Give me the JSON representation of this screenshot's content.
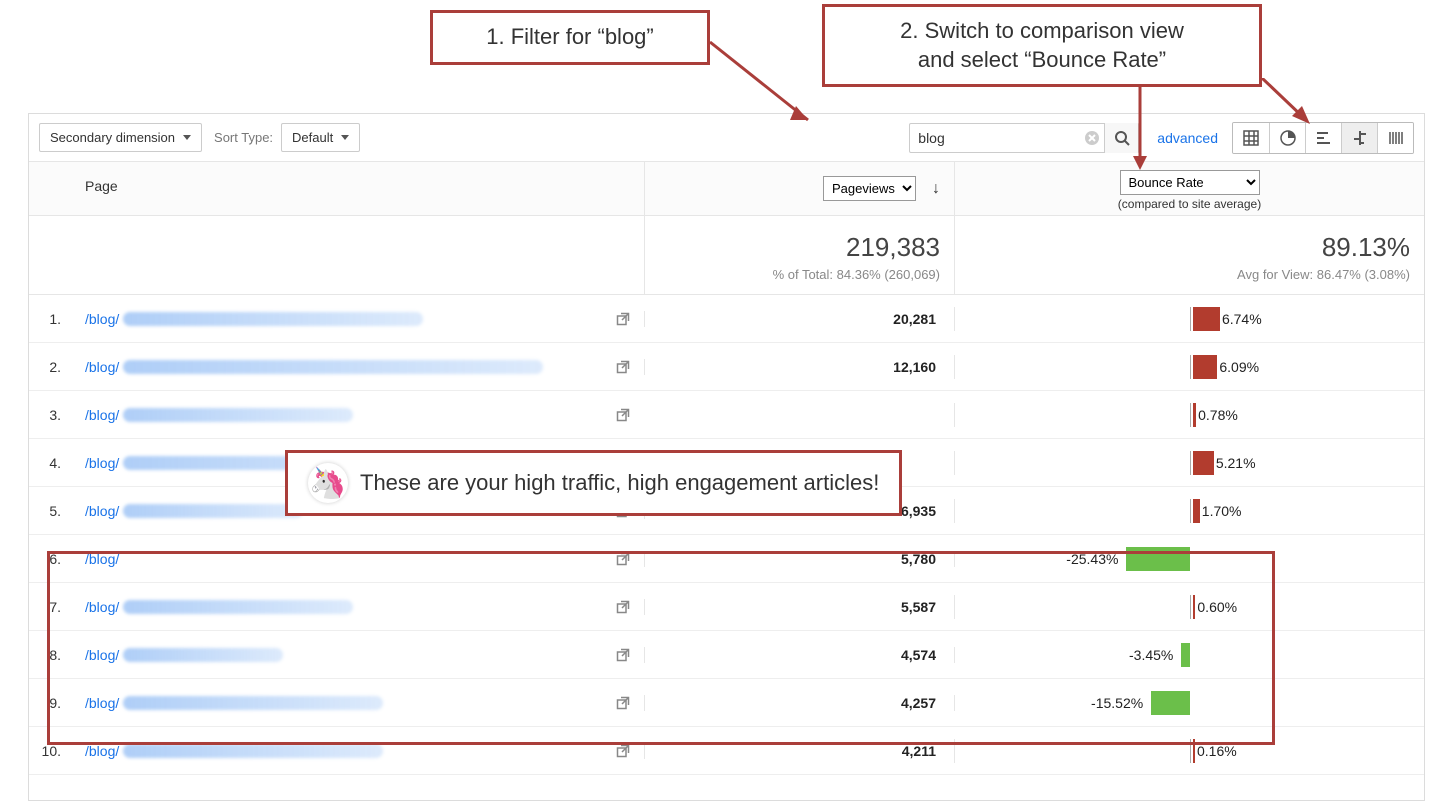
{
  "callouts": {
    "filter": "1. Filter for “blog”",
    "compare": "2. Switch to comparison view\nand select “Bounce Rate”",
    "annotation": "These are your high traffic, high engagement articles!",
    "unicorn": "🦄"
  },
  "toolbar": {
    "secondary_dimension": "Secondary dimension",
    "sort_type_label": "Sort Type:",
    "sort_type_value": "Default",
    "search_value": "blog",
    "advanced": "advanced"
  },
  "headers": {
    "page": "Page",
    "pageviews": "Pageviews",
    "bounce_rate": "Bounce Rate",
    "compared": "(compared to site average)"
  },
  "summary": {
    "pageviews": "219,383",
    "pageviews_note": "% of Total: 84.36% (260,069)",
    "bounce_rate": "89.13%",
    "bounce_note": "Avg for View: 86.47% (3.08%)"
  },
  "chart_data": {
    "type": "table",
    "axis_center_pct": 0,
    "rows": [
      {
        "idx": "1.",
        "page": "/blog/",
        "pageviews": "20,281",
        "pct": 6.74,
        "label": "6.74%"
      },
      {
        "idx": "2.",
        "page": "/blog/",
        "pageviews": "12,160",
        "pct": 6.09,
        "label": "6.09%"
      },
      {
        "idx": "3.",
        "page": "/blog/",
        "pageviews": "",
        "pct": 0.78,
        "label": "0.78%"
      },
      {
        "idx": "4.",
        "page": "/blog/",
        "pageviews": "",
        "pct": 5.21,
        "label": "5.21%"
      },
      {
        "idx": "5.",
        "page": "/blog/",
        "pageviews": "6,935",
        "pct": 1.7,
        "label": "1.70%"
      },
      {
        "idx": "6.",
        "page": "/blog/",
        "pageviews": "5,780",
        "pct": -25.43,
        "label": "-25.43%"
      },
      {
        "idx": "7.",
        "page": "/blog/",
        "pageviews": "5,587",
        "pct": 0.6,
        "label": "0.60%"
      },
      {
        "idx": "8.",
        "page": "/blog/",
        "pageviews": "4,574",
        "pct": -3.45,
        "label": "-3.45%"
      },
      {
        "idx": "9.",
        "page": "/blog/",
        "pageviews": "4,257",
        "pct": -15.52,
        "label": "-15.52%"
      },
      {
        "idx": "10.",
        "page": "/blog/",
        "pageviews": "4,211",
        "pct": 0.16,
        "label": "0.16%"
      }
    ]
  }
}
